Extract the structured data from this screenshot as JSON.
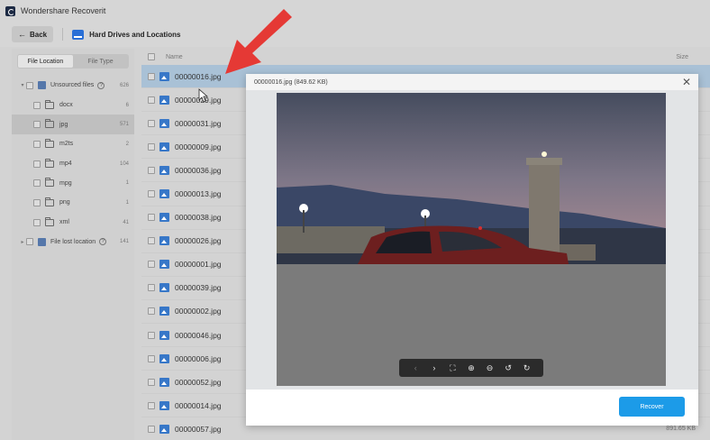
{
  "app": {
    "title": "Wondershare Recoverit"
  },
  "nav": {
    "back_label": "Back",
    "location": "Hard Drives and Locations"
  },
  "sidebar": {
    "tabs": [
      "File Location",
      "File Type"
    ],
    "tree": [
      {
        "label": "Unsourced files",
        "count": "626",
        "type": "root"
      },
      {
        "label": "docx",
        "count": "6",
        "type": "folder"
      },
      {
        "label": "jpg",
        "count": "571",
        "type": "folder",
        "selected": true
      },
      {
        "label": "m2ts",
        "count": "2",
        "type": "folder"
      },
      {
        "label": "mp4",
        "count": "104",
        "type": "folder"
      },
      {
        "label": "mpg",
        "count": "1",
        "type": "folder"
      },
      {
        "label": "png",
        "count": "1",
        "type": "folder"
      },
      {
        "label": "xml",
        "count": "41",
        "type": "folder"
      },
      {
        "label": "File lost location",
        "count": "141",
        "type": "root"
      }
    ]
  },
  "list": {
    "col_name": "Name",
    "col_size": "Size",
    "files": [
      {
        "name": "00000016.jpg",
        "size": ""
      },
      {
        "name": "00000029.jpg",
        "size": ""
      },
      {
        "name": "00000031.jpg",
        "size": ""
      },
      {
        "name": "00000009.jpg",
        "size": ""
      },
      {
        "name": "00000036.jpg",
        "size": ""
      },
      {
        "name": "00000013.jpg",
        "size": ""
      },
      {
        "name": "00000038.jpg",
        "size": ""
      },
      {
        "name": "00000026.jpg",
        "size": ""
      },
      {
        "name": "00000001.jpg",
        "size": ""
      },
      {
        "name": "00000039.jpg",
        "size": ""
      },
      {
        "name": "00000002.jpg",
        "size": ""
      },
      {
        "name": "00000046.jpg",
        "size": ""
      },
      {
        "name": "00000006.jpg",
        "size": ""
      },
      {
        "name": "00000052.jpg",
        "size": ""
      },
      {
        "name": "00000014.jpg",
        "size": ""
      },
      {
        "name": "00000057.jpg",
        "size": "891.65 KB"
      }
    ]
  },
  "preview": {
    "title": "00000016.jpg (849.62 KB)",
    "close_icon": "close-icon",
    "recover_label": "Recover",
    "toolbar": [
      "chevron-left-icon",
      "chevron-right-icon",
      "fullscreen-icon",
      "zoom-in-icon",
      "zoom-out-icon",
      "rotate-left-icon",
      "rotate-right-icon"
    ]
  },
  "colors": {
    "accent": "#1c9be8",
    "highlight_row": "#a9c1d6",
    "annotation": "#e53935"
  }
}
